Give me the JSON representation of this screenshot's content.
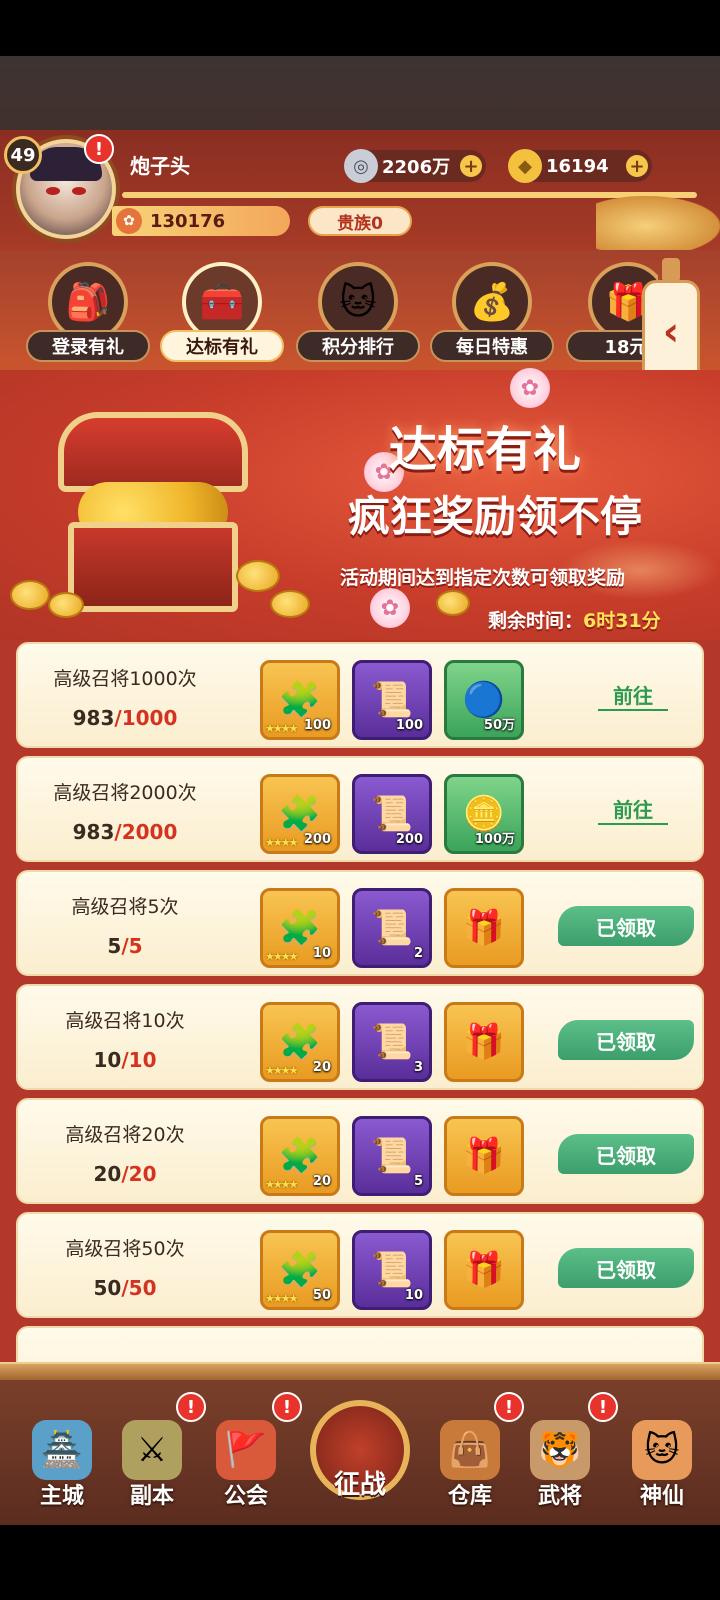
{
  "player": {
    "name": "炮子头",
    "level": "49",
    "paw_points": "130176",
    "noble": "贵族0"
  },
  "resources": {
    "silver": "2206万",
    "gold": "16194"
  },
  "tabs": [
    {
      "label": "登录有礼",
      "icon": "gift-bag-icon"
    },
    {
      "label": "达标有礼",
      "icon": "treasure-chest-icon",
      "active": true
    },
    {
      "label": "积分排行",
      "icon": "lucky-cat-icon"
    },
    {
      "label": "每日特惠",
      "icon": "fortune-bag-icon"
    },
    {
      "label": "18元",
      "icon": "gift-box-icon"
    }
  ],
  "banner": {
    "title": "达标有礼",
    "subtitle": "疯狂奖励领不停",
    "description": "活动期间达到指定次数可领取奖励",
    "countdown_label": "剩余时间：",
    "countdown_value": "6时31分"
  },
  "tasks": [
    {
      "title": "高级召将1000次",
      "current": "983",
      "goal": "/1000",
      "rewards": [
        {
          "qty": "100",
          "stars": "★★★★"
        },
        {
          "qty": "100"
        },
        {
          "qty": "50万"
        }
      ],
      "action": "前往",
      "claimed": false
    },
    {
      "title": "高级召将2000次",
      "current": "983",
      "goal": "/2000",
      "rewards": [
        {
          "qty": "200",
          "stars": "★★★★"
        },
        {
          "qty": "200"
        },
        {
          "qty": "100万"
        }
      ],
      "action": "前往",
      "claimed": false
    },
    {
      "title": "高级召将5次",
      "current": "5",
      "goal": "/5",
      "rewards": [
        {
          "qty": "10",
          "stars": "★★★★"
        },
        {
          "qty": "2"
        },
        {
          "qty": ""
        }
      ],
      "action": "已领取",
      "claimed": true
    },
    {
      "title": "高级召将10次",
      "current": "10",
      "goal": "/10",
      "rewards": [
        {
          "qty": "20",
          "stars": "★★★★"
        },
        {
          "qty": "3"
        },
        {
          "qty": ""
        }
      ],
      "action": "已领取",
      "claimed": true
    },
    {
      "title": "高级召将20次",
      "current": "20",
      "goal": "/20",
      "rewards": [
        {
          "qty": "20",
          "stars": "★★★★"
        },
        {
          "qty": "5"
        },
        {
          "qty": ""
        }
      ],
      "action": "已领取",
      "claimed": true
    },
    {
      "title": "高级召将50次",
      "current": "50",
      "goal": "/50",
      "rewards": [
        {
          "qty": "50",
          "stars": "★★★★"
        },
        {
          "qty": "10"
        },
        {
          "qty": ""
        }
      ],
      "action": "已领取",
      "claimed": true
    }
  ],
  "nav": [
    {
      "label": "主城",
      "icon": "castle-icon"
    },
    {
      "label": "副本",
      "icon": "swords-icon",
      "alert": true
    },
    {
      "label": "公会",
      "icon": "flag-icon",
      "alert": true
    },
    {
      "label": "征战",
      "icon": "battle-icon"
    },
    {
      "label": "仓库",
      "icon": "bag-icon",
      "alert": true
    },
    {
      "label": "武将",
      "icon": "general-icon",
      "alert": true
    },
    {
      "label": "神仙",
      "icon": "cat-icon"
    }
  ],
  "colors": {
    "accent_red": "#c73c2a",
    "claimed_green": "#3c9e6a",
    "goal_red": "#d3331f",
    "gold": "#f6c74b"
  }
}
